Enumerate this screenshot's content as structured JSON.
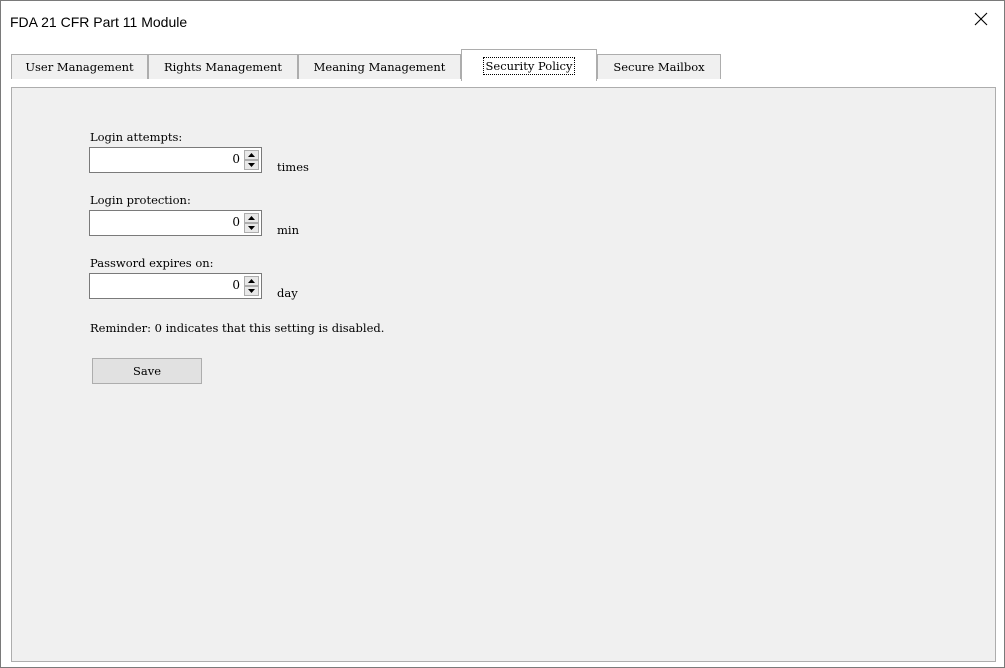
{
  "window": {
    "title": "FDA 21 CFR Part 11 Module",
    "close_icon": "close-icon"
  },
  "tabs": [
    {
      "label": "User Management",
      "active": false
    },
    {
      "label": "Rights Management",
      "active": false
    },
    {
      "label": "Meaning Management",
      "active": false
    },
    {
      "label": "Security Policy",
      "active": true
    },
    {
      "label": "Secure Mailbox",
      "active": false
    }
  ],
  "form": {
    "login_attempts": {
      "label": "Login attempts:",
      "value": "0",
      "unit": "times"
    },
    "login_protection": {
      "label": "Login protection:",
      "value": "0",
      "unit": "min"
    },
    "password_expires": {
      "label": "Password expires on:",
      "value": "0",
      "unit": "day"
    },
    "reminder": "Reminder: 0 indicates that this setting is disabled.",
    "save_label": "Save"
  },
  "colors": {
    "panel_background": "#f0f0f0",
    "border": "#adadad",
    "button_background": "#e1e1e1"
  }
}
